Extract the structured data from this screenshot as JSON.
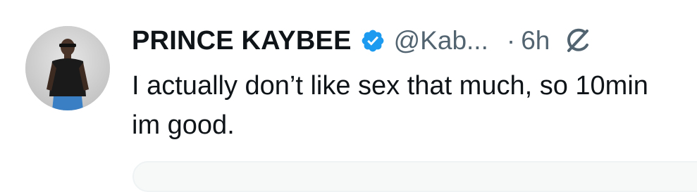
{
  "tweet": {
    "author": {
      "display_name": "PRINCE KAYBEE",
      "handle": "@Kab...",
      "verified": true,
      "avatar_icon": "profile-photo"
    },
    "separator": "·",
    "timestamp": "6h",
    "grok_icon": "grok-icon",
    "text": "I actually don’t like sex that much, so 10min im good.",
    "colors": {
      "verified_badge": "#1d9bf0",
      "secondary_text": "#536471",
      "primary_text": "#0f1419"
    }
  }
}
